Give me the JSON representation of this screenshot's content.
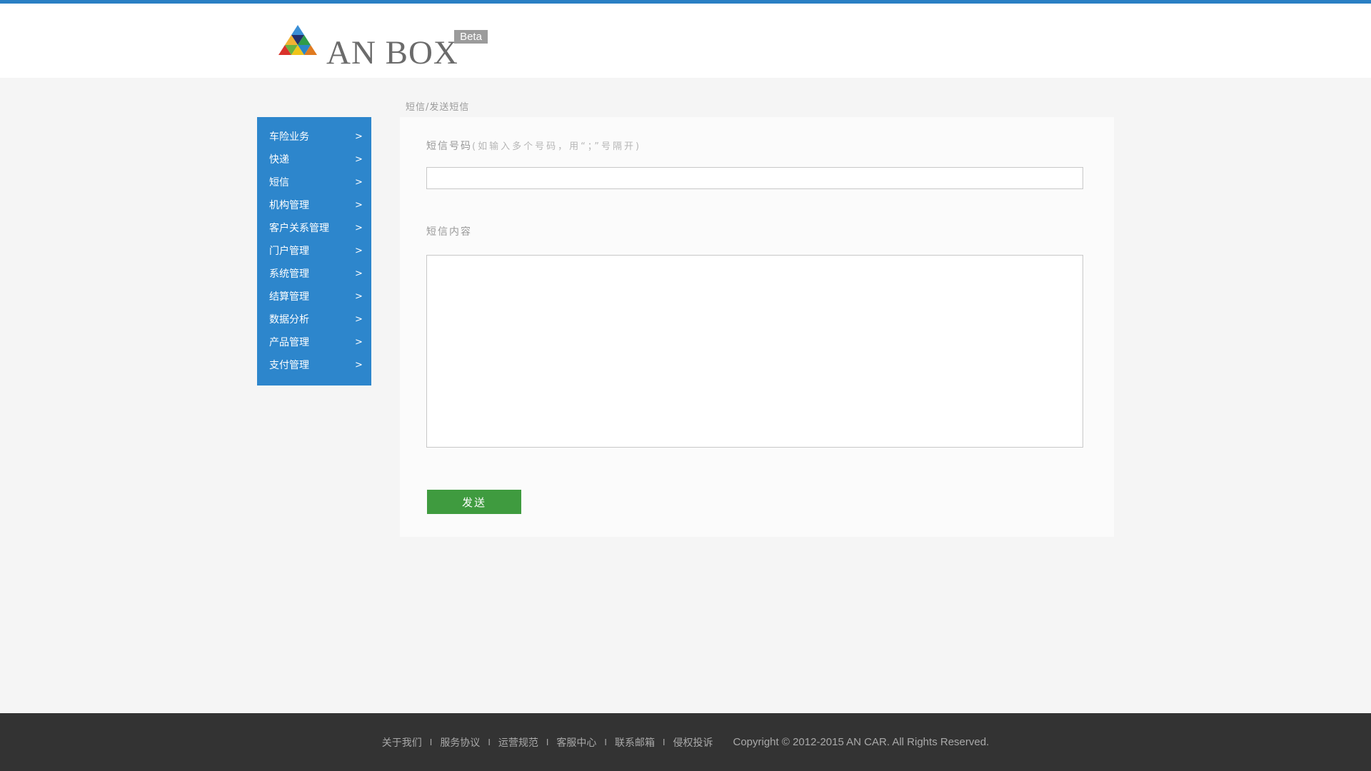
{
  "brand": {
    "logo_text": "AN BOX",
    "badge": "Beta",
    "accent_color": "#2a7fc4"
  },
  "sidebar": {
    "items": [
      {
        "label": "车险业务",
        "arrow": ">"
      },
      {
        "label": "快递",
        "arrow": ">"
      },
      {
        "label": "短信",
        "arrow": ">"
      },
      {
        "label": "机构管理",
        "arrow": ">"
      },
      {
        "label": "客户关系管理",
        "arrow": ">"
      },
      {
        "label": "门户管理",
        "arrow": ">"
      },
      {
        "label": "系统管理",
        "arrow": ">"
      },
      {
        "label": "结算管理",
        "arrow": ">"
      },
      {
        "label": "数据分析",
        "arrow": ">"
      },
      {
        "label": "产品管理",
        "arrow": ">"
      },
      {
        "label": "支付管理",
        "arrow": ">"
      }
    ],
    "color": "#2d86cc"
  },
  "breadcrumb": "短信/发送短信",
  "form": {
    "phone_label": "短信号码",
    "phone_hint": "(如输入多个号码，用“；”号隔开)",
    "phone_value": "",
    "content_label": "短信内容",
    "content_value": "",
    "send_label": "发送",
    "send_color": "#3f9b3f"
  },
  "footer": {
    "links": [
      "关于我们",
      "服务协议",
      "运营规范",
      "客服中心",
      "联系邮箱",
      "侵权投诉"
    ],
    "separator": "I",
    "copyright": "Copyright © 2012-2015 AN CAR.  All Rights Reserved."
  }
}
